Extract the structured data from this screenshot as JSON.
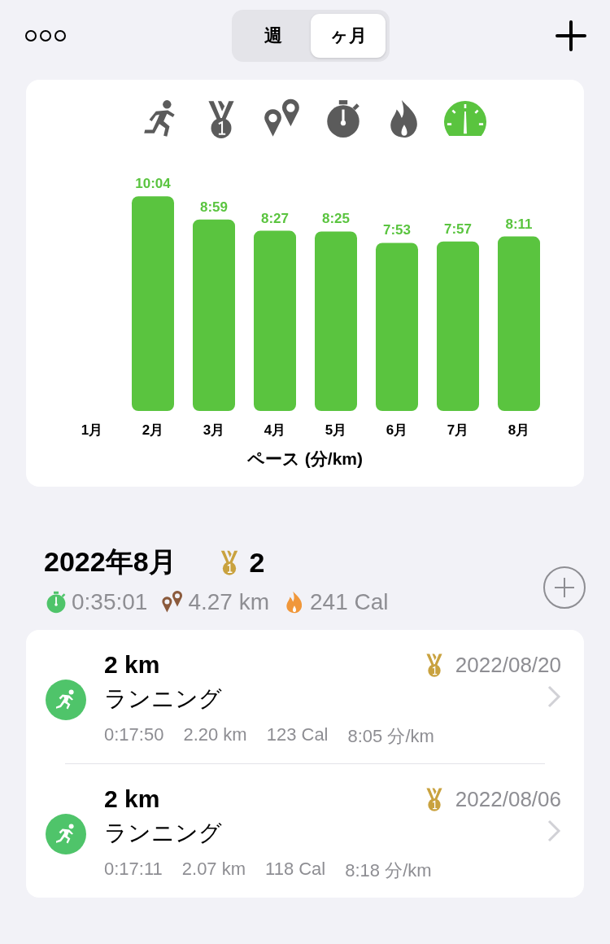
{
  "segment_tabs": [
    {
      "label": "週",
      "selected": false
    },
    {
      "label": "ヶ月",
      "selected": true
    }
  ],
  "metric_tabs": [
    {
      "kind": "runner",
      "selected": false
    },
    {
      "kind": "medal",
      "selected": false
    },
    {
      "kind": "pins",
      "selected": false
    },
    {
      "kind": "stopwatch",
      "selected": false
    },
    {
      "kind": "flame",
      "selected": false
    },
    {
      "kind": "gauge",
      "selected": true
    }
  ],
  "chart_data": {
    "type": "bar",
    "xlabel": "ペース (分/km)",
    "categories": [
      "1月",
      "2月",
      "3月",
      "4月",
      "5月",
      "6月",
      "7月",
      "8月"
    ],
    "values": [
      null,
      10.067,
      8.983,
      8.45,
      8.417,
      7.883,
      7.95,
      8.183
    ],
    "value_labels": [
      null,
      "10:04",
      "8:59",
      "8:27",
      "8:25",
      "7:53",
      "7:57",
      "8:11"
    ]
  },
  "summary": {
    "title": "2022年8月",
    "medal_count": "2",
    "stats": [
      {
        "kind": "stopwatch",
        "text": "0:35:01"
      },
      {
        "kind": "pins",
        "text": "4.27 km"
      },
      {
        "kind": "flame",
        "text": "241 Cal"
      }
    ]
  },
  "activities": [
    {
      "title": "2 km",
      "medal": true,
      "date": "2022/08/20",
      "name": "ランニング",
      "stats": [
        "0:17:50",
        "2.20 km",
        "123 Cal",
        "8:05 分/km"
      ]
    },
    {
      "title": "2 km",
      "medal": true,
      "date": "2022/08/06",
      "name": "ランニング",
      "stats": [
        "0:17:11",
        "2.07 km",
        "118 Cal",
        "8:18 分/km"
      ]
    }
  ]
}
